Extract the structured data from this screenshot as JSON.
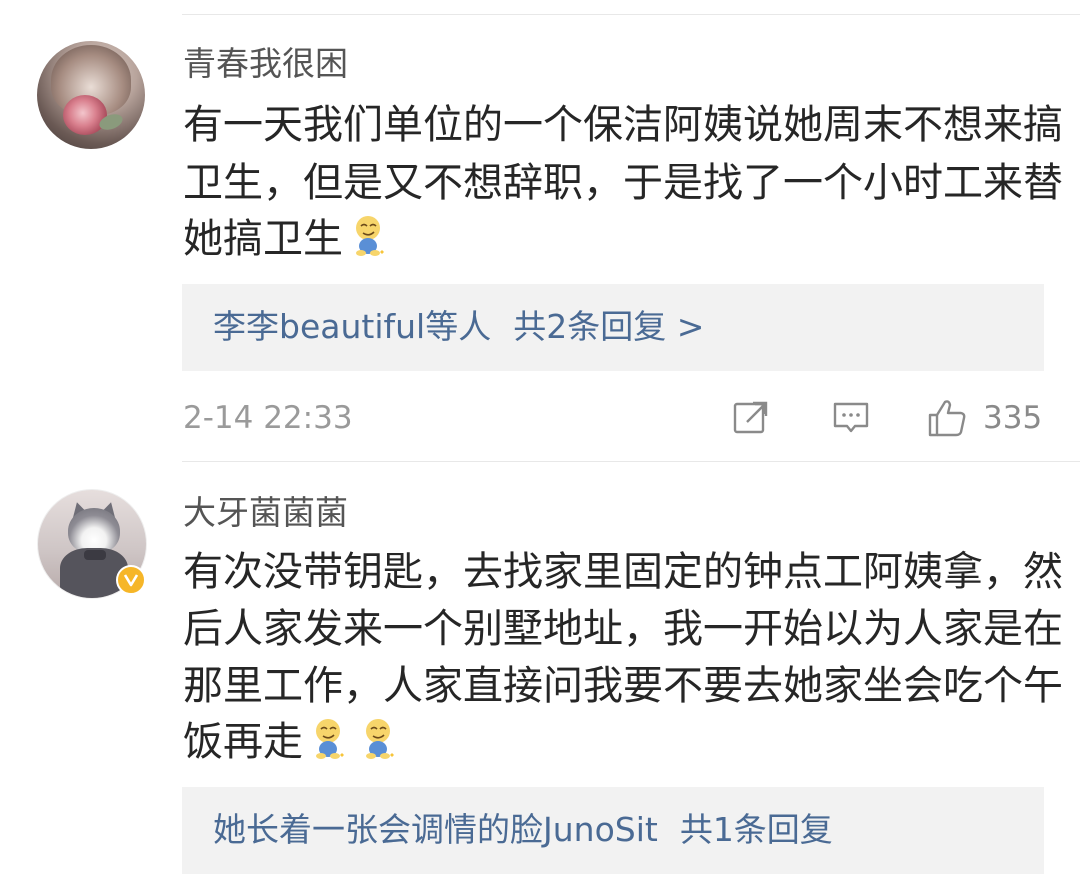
{
  "comments": [
    {
      "username": "青春我很困",
      "text_lines": [
        "有一天我们单位的一个保洁阿姨说她周末不想来搞",
        "卫生，但是又不想辞职，于是找了一个小时工来替",
        "她搞卫生"
      ],
      "emoji_icons": [
        "smirk-emoji-icon"
      ],
      "reply_preview": {
        "users": "李李beautiful等人",
        "count_text": "共2条回复 >"
      },
      "timestamp": "2-14 22:33",
      "like_count": "335",
      "verified": false
    },
    {
      "username": "大牙菌菌菌",
      "text_lines": [
        "有次没带钥匙，去找家里固定的钟点工阿姨拿，然",
        "后人家发来一个别墅地址，我一开始以为人家是在",
        "那里工作，人家直接问我要不要去她家坐会吃个午",
        "饭再走"
      ],
      "emoji_icons": [
        "smirk-emoji-icon",
        "smirk-emoji-icon"
      ],
      "reply_preview": {
        "users": "她长着一张会调情的脸JunoSit",
        "count_text": "共1条回复"
      },
      "verified": true
    }
  ],
  "icons": {
    "share": "share-icon",
    "comment": "comment-icon",
    "like": "thumbs-up-icon",
    "verified": "verified-badge-icon"
  },
  "colors": {
    "link": "#4a6a94",
    "verified_badge": "#f6b628",
    "reply_box_bg": "#f2f2f2"
  }
}
